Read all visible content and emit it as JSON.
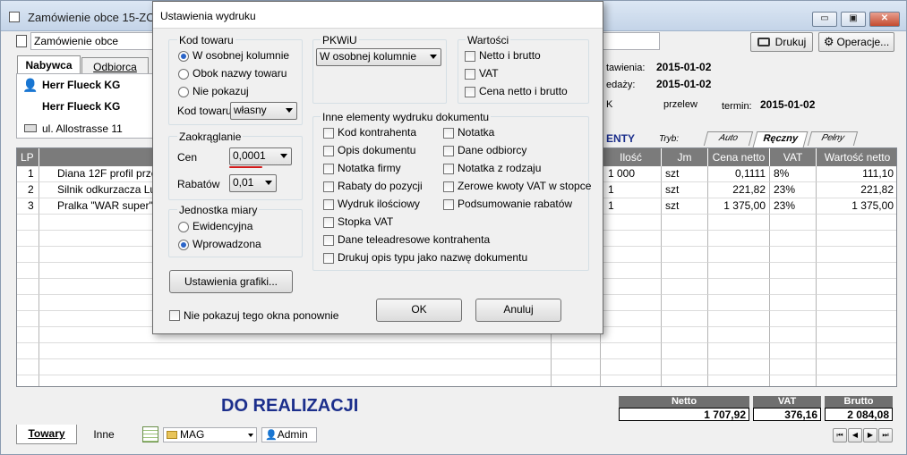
{
  "window": {
    "title": "Zamówienie obce 15-ZO/0",
    "controls": {
      "minimize": "▭",
      "maximize": "▣",
      "close": "✕"
    }
  },
  "toolbar": {
    "doc_name_value": "Zamówienie obce",
    "print_label": "Drukuj",
    "operations_label": "Operacje..."
  },
  "party_tabs": [
    "Nabywca",
    "Odbiorca"
  ],
  "buyer": {
    "name1": "Herr Flueck KG",
    "name2": "Herr Flueck KG",
    "address": "ul. Allostrasse 11"
  },
  "doc_info": {
    "issue_label": "tawienia:",
    "issue_date": "2015-01-02",
    "sale_label": "edaży:",
    "sale_date": "2015-01-02",
    "payment_prefix": "K",
    "payment_method": "przelew",
    "due_label": "termin:",
    "due_date": "2015-01-02"
  },
  "mode": {
    "section_label": "ENTY",
    "type_label": "Tryb:",
    "tabs": [
      "Auto",
      "Ręczny",
      "Pełny"
    ]
  },
  "grid": {
    "columns": [
      "LP",
      "",
      "",
      "Ilość",
      "Jm",
      "Cena netto",
      "VAT",
      "Wartość netto"
    ],
    "rows": [
      {
        "lp": "1",
        "name": "Diana 12F profil przedn",
        "qty": "1 000",
        "unit": "szt",
        "price": "0,1111",
        "vat": "8%",
        "value": "111,10"
      },
      {
        "lp": "2",
        "name": "Silnik odkurzacza Luna",
        "qty": "1",
        "unit": "szt",
        "price": "221,82",
        "vat": "23%",
        "value": "221,82"
      },
      {
        "lp": "3",
        "name": "Pralka \"WAR super\"",
        "qty": "1",
        "unit": "szt",
        "price": "1 375,00",
        "vat": "23%",
        "value": "1 375,00"
      }
    ]
  },
  "status_text": "DO REALIZACJI",
  "totals": {
    "netto_label": "Netto",
    "netto": "1 707,92",
    "vat_label": "VAT",
    "vat": "376,16",
    "brutto_label": "Brutto",
    "brutto": "2 084,08"
  },
  "bottom": {
    "tabs": [
      "Towary",
      "Inne"
    ],
    "warehouse": "MAG",
    "user": "Admin",
    "nav": [
      "⏮",
      "◀",
      "▶",
      "⏭"
    ]
  },
  "dialog": {
    "title": "Ustawienia wydruku",
    "kod_towaru": {
      "label": "Kod towaru",
      "options": [
        "W osobnej kolumnie",
        "Obok nazwy towaru",
        "Nie pokazuj"
      ],
      "selected_index": 0,
      "combo_label": "Kod towaru:",
      "combo_value": "własny"
    },
    "zaokraglanie": {
      "label": "Zaokrąglanie",
      "cen_label": "Cen",
      "cen_value": "0,0001",
      "rabatow_label": "Rabatów",
      "rabatow_value": "0,01"
    },
    "jednostka": {
      "label": "Jednostka miary",
      "options": [
        "Ewidencyjna",
        "Wprowadzona"
      ],
      "selected_index": 1
    },
    "pkwiu": {
      "label": "PKWiU",
      "value": "W osobnej kolumnie"
    },
    "wartosci": {
      "label": "Wartości",
      "options": [
        "Netto i brutto",
        "VAT",
        "Cena netto i brutto"
      ]
    },
    "inne": {
      "label": "Inne elementy wydruku dokumentu",
      "left": [
        "Kod kontrahenta",
        "Opis dokumentu",
        "Notatka firmy",
        "Rabaty do pozycji",
        "Wydruk ilościowy",
        "Stopka VAT",
        "Dane teleadresowe kontrahenta",
        "Drukuj opis typu jako nazwę dokumentu"
      ],
      "right": [
        "Notatka",
        "Dane odbiorcy",
        "Notatka z rodzaju",
        "Zerowe kwoty VAT w stopce",
        "Podsumowanie rabatów"
      ]
    },
    "graphics_button": "Ustawienia grafiki...",
    "dont_show": "Nie pokazuj tego okna ponownie",
    "ok": "OK",
    "cancel": "Anuluj"
  }
}
